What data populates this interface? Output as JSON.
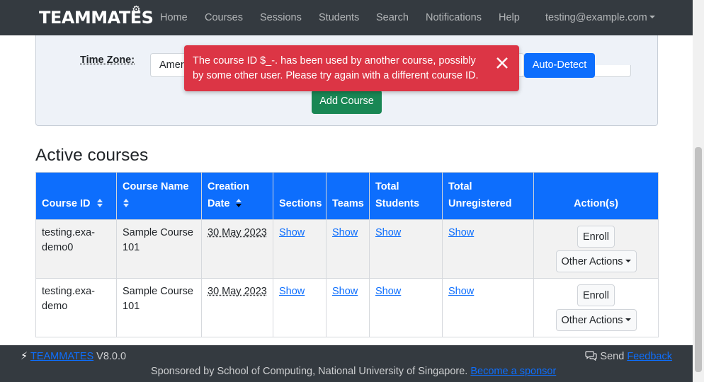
{
  "navbar": {
    "brand": "TEAMMATES",
    "items": [
      "Home",
      "Courses",
      "Sessions",
      "Students",
      "Search",
      "Notifications",
      "Help"
    ],
    "user": "testing@example.com"
  },
  "add_course": {
    "timezone_label": "Time Zone:",
    "timezone_value": "Ameri",
    "autodetect_label": "Auto-Detect",
    "add_label": "Add Course"
  },
  "toast": {
    "message": "The course ID $_-. has been used by another course, possibly by some other user. Please try again with a different course ID.",
    "color": "#dc3545"
  },
  "active_courses": {
    "title": "Active courses",
    "headers": {
      "course_id": "Course ID",
      "course_name": "Course Name",
      "creation_date": "Creation Date",
      "sections": "Sections",
      "teams": "Teams",
      "total_students": "Total Students",
      "total_unregistered": "Total Unregistered",
      "actions": "Action(s)"
    },
    "rows": [
      {
        "course_id": "testing.exa-demo0",
        "course_name": "Sample Course 101",
        "creation_date": "30 May 2023",
        "sections": "Show",
        "teams": "Show",
        "total_students": "Show",
        "total_unregistered": "Show",
        "enroll": "Enroll",
        "other": "Other Actions"
      },
      {
        "course_id": "testing.exa-demo",
        "course_name": "Sample Course 101",
        "creation_date": "30 May 2023",
        "sections": "Show",
        "teams": "Show",
        "total_students": "Show",
        "total_unregistered": "Show",
        "enroll": "Enroll",
        "other": "Other Actions"
      }
    ]
  },
  "footer": {
    "product": "TEAMMATES",
    "version": "V8.0.0",
    "send": "Send",
    "feedback": "Feedback",
    "sponsor_text": "Sponsored by School of Computing, National University of Singapore.",
    "sponsor_link": "Become a sponsor"
  },
  "colors": {
    "primary": "#0d6efd",
    "success": "#198754",
    "danger": "#dc3545",
    "navbar": "#343a40"
  }
}
